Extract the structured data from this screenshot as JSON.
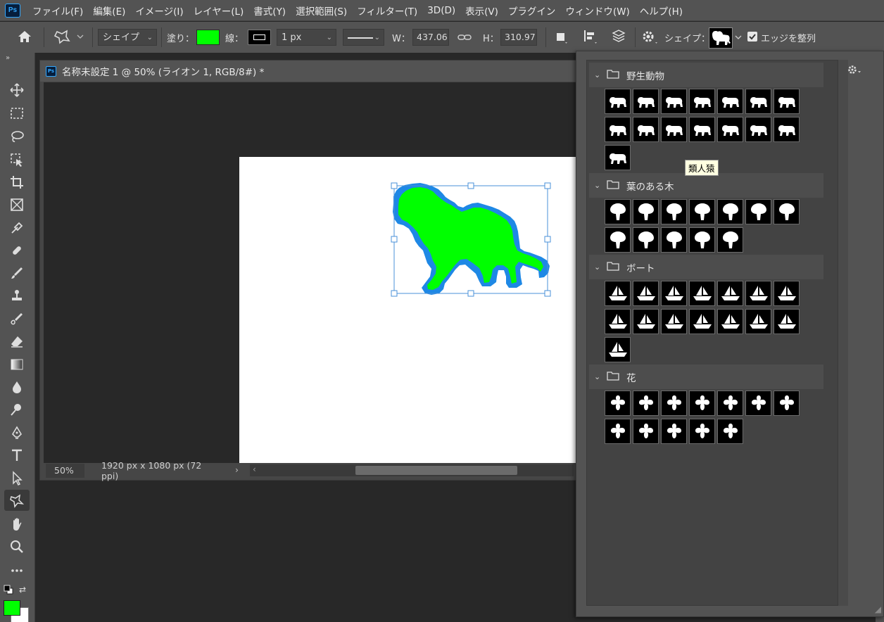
{
  "app": {
    "logo_text": "Ps",
    "menu": [
      "ファイル(F)",
      "編集(E)",
      "イメージ(I)",
      "レイヤー(L)",
      "書式(Y)",
      "選択範囲(S)",
      "フィルター(T)",
      "3D(D)",
      "表示(V)",
      "プラグイン",
      "ウィンドウ(W)",
      "ヘルプ(H)"
    ]
  },
  "options": {
    "mode": "シェイプ",
    "fill_label": "塗り：",
    "stroke_label": "線：",
    "stroke_width": "1 px",
    "w_label": "W：",
    "w_value": "437.06",
    "h_label": "H：",
    "h_value": "310.97",
    "shape_label": "シェイプ：",
    "align_edges_label": "エッジを整列",
    "align_edges_checked": true,
    "fill_color": "#00ff00",
    "stroke_color": "#000000"
  },
  "document": {
    "tab_title": "名称未設定 1 @ 50% (ライオン 1, RGB/8#) *",
    "zoom": "50%",
    "info": "1920 px x 1080 px (72 ppi)",
    "shape_fill": "#00ff00",
    "shape_stroke": "#1e88e5"
  },
  "colors": {
    "foreground": "#00ff00",
    "background": "#ffffff"
  },
  "panel": {
    "groups": [
      {
        "name": "野生動物",
        "icons": [
          "polar-bear",
          "lion",
          "rhino",
          "bird",
          "wolf",
          "camel",
          "turtle",
          "giraffe",
          "kangaroo",
          "gorilla",
          "gazelle",
          "elephant",
          "cheetah",
          "moose",
          "deer"
        ]
      },
      {
        "name": "葉のある木",
        "icons": [
          "tree-1",
          "tree-2",
          "palm",
          "tree-3",
          "tree-4",
          "tree-5",
          "tree-6",
          "tree-7",
          "tree-8",
          "palm-2",
          "pine",
          "tree-9"
        ]
      },
      {
        "name": "ボート",
        "icons": [
          "canoe",
          "boat",
          "ship",
          "motorboat",
          "sailboat",
          "speedboat",
          "schooner",
          "sailboat-2",
          "sailboat-3",
          "ship-2",
          "yacht",
          "ship-3",
          "ship-4",
          "ship-5",
          "submarine"
        ]
      },
      {
        "name": "花",
        "icons": [
          "flower-1",
          "flower-2",
          "flower-3",
          "flower-4",
          "flower-5",
          "flower-6",
          "flower-7",
          "flower-8",
          "flower-9",
          "flower-10",
          "flower-11",
          "flower-12"
        ]
      }
    ],
    "tooltip": "類人猿"
  }
}
